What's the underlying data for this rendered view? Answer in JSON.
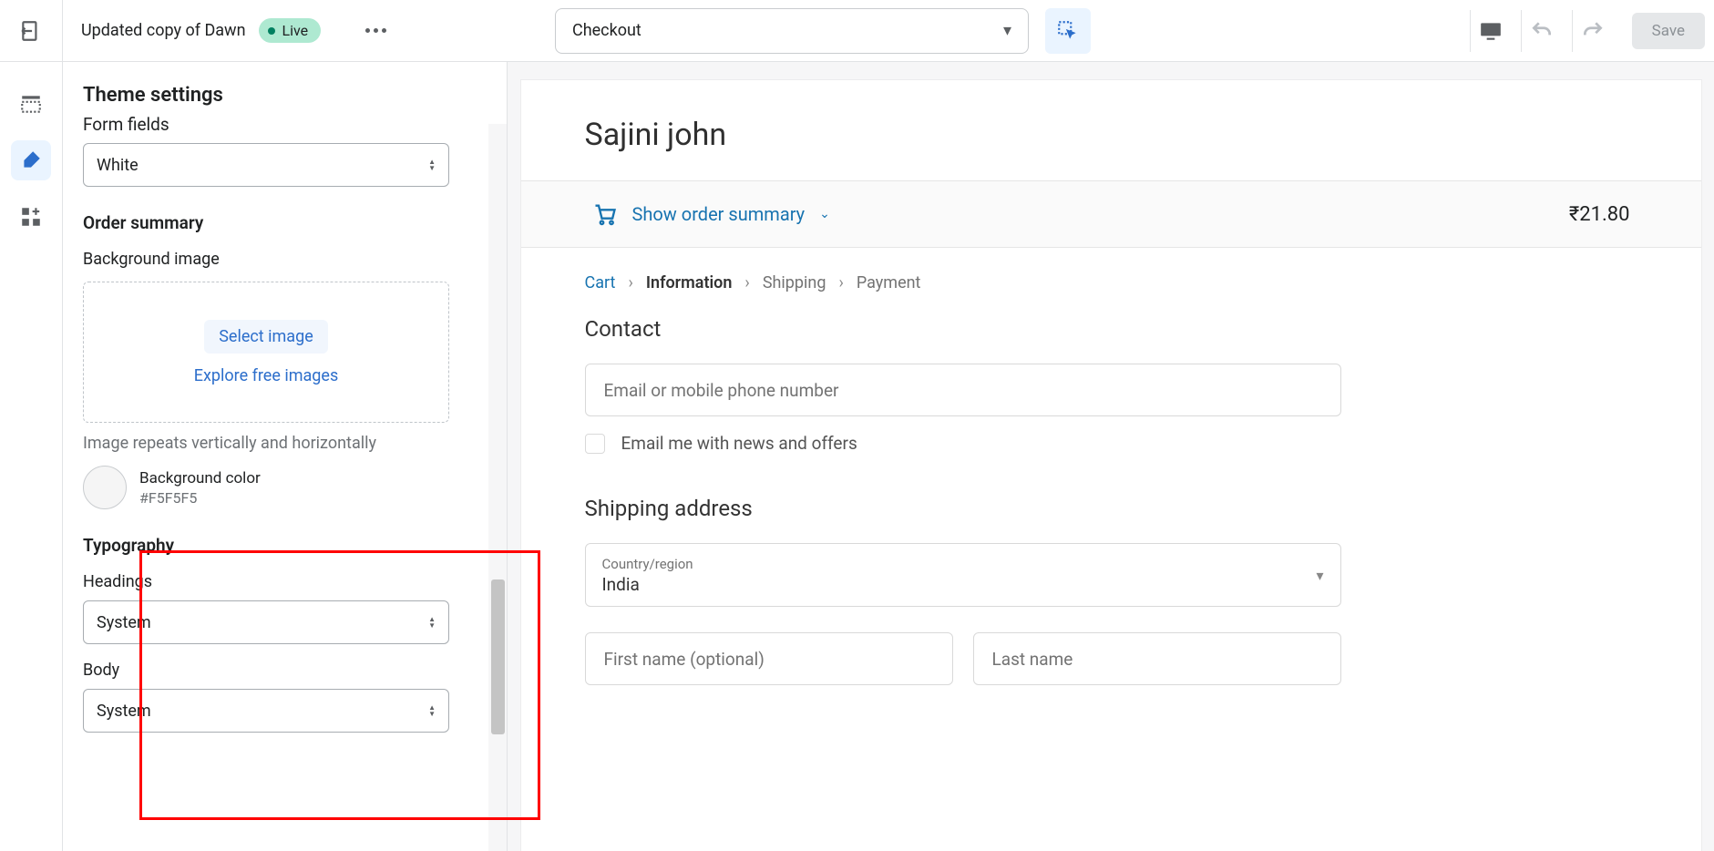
{
  "topbar": {
    "theme_name": "Updated copy of Dawn",
    "live_label": "Live",
    "page_select": "Checkout",
    "save_label": "Save"
  },
  "panel": {
    "title": "Theme settings",
    "form_fields_label": "Form fields",
    "form_fields_value": "White",
    "order_summary_heading": "Order summary",
    "bg_image_label": "Background image",
    "select_image_label": "Select image",
    "explore_images_label": "Explore free images",
    "repeat_help": "Image repeats vertically and horizontally",
    "bg_color_label": "Background color",
    "bg_color_hex": "#F5F5F5",
    "typography_heading": "Typography",
    "headings_label": "Headings",
    "headings_value": "System",
    "body_label": "Body",
    "body_value": "System"
  },
  "checkout": {
    "store_name": "Sajini john",
    "order_summary_toggle": "Show order summary",
    "order_total": "₹21.80",
    "breadcrumbs": {
      "cart": "Cart",
      "information": "Information",
      "shipping": "Shipping",
      "payment": "Payment"
    },
    "contact_heading": "Contact",
    "email_placeholder": "Email or mobile phone number",
    "newsletter_label": "Email me with news and offers",
    "shipping_heading": "Shipping address",
    "country_label": "Country/region",
    "country_value": "India",
    "first_name_placeholder": "First name (optional)",
    "last_name_placeholder": "Last name"
  }
}
